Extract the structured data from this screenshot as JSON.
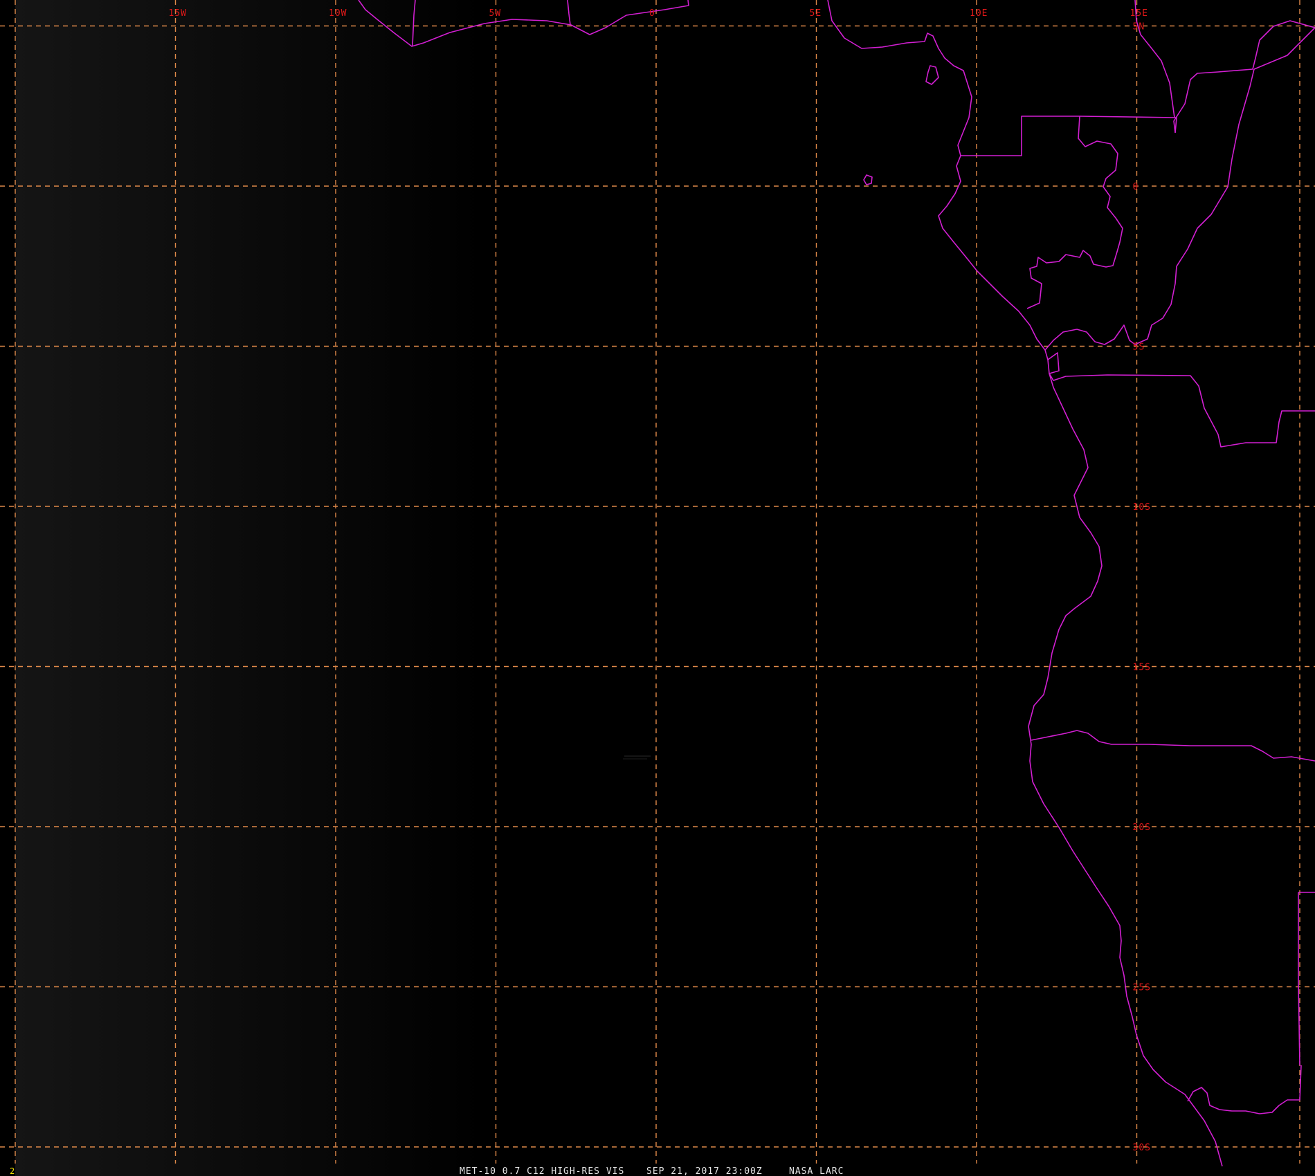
{
  "map": {
    "background_color": "#000000",
    "grid_color": "#e08a4a",
    "boundary_color": "#d21fd2",
    "label_color": "#e01818",
    "longitudes": [
      {
        "value": -15,
        "label": "15W"
      },
      {
        "value": -10,
        "label": "10W"
      },
      {
        "value": -5,
        "label": "5W"
      },
      {
        "value": 0,
        "label": "0"
      },
      {
        "value": 5,
        "label": "5E"
      },
      {
        "value": 10,
        "label": "10E"
      },
      {
        "value": 15,
        "label": "15E"
      }
    ],
    "latitudes": [
      {
        "value": 5,
        "label": "5N"
      },
      {
        "value": 0,
        "label": "0"
      },
      {
        "value": -5,
        "label": "5S"
      },
      {
        "value": -10,
        "label": "10S"
      },
      {
        "value": -15,
        "label": "15S"
      },
      {
        "value": -20,
        "label": "20S"
      },
      {
        "value": -25,
        "label": "25S"
      },
      {
        "value": -30,
        "label": "30S"
      }
    ]
  },
  "footer": {
    "frame_number": "2",
    "product": "MET-10 0.7 C12 HIGH-RES VIS",
    "datetime": "SEP 21, 2017 23:00Z",
    "source": "NASA LARC"
  }
}
